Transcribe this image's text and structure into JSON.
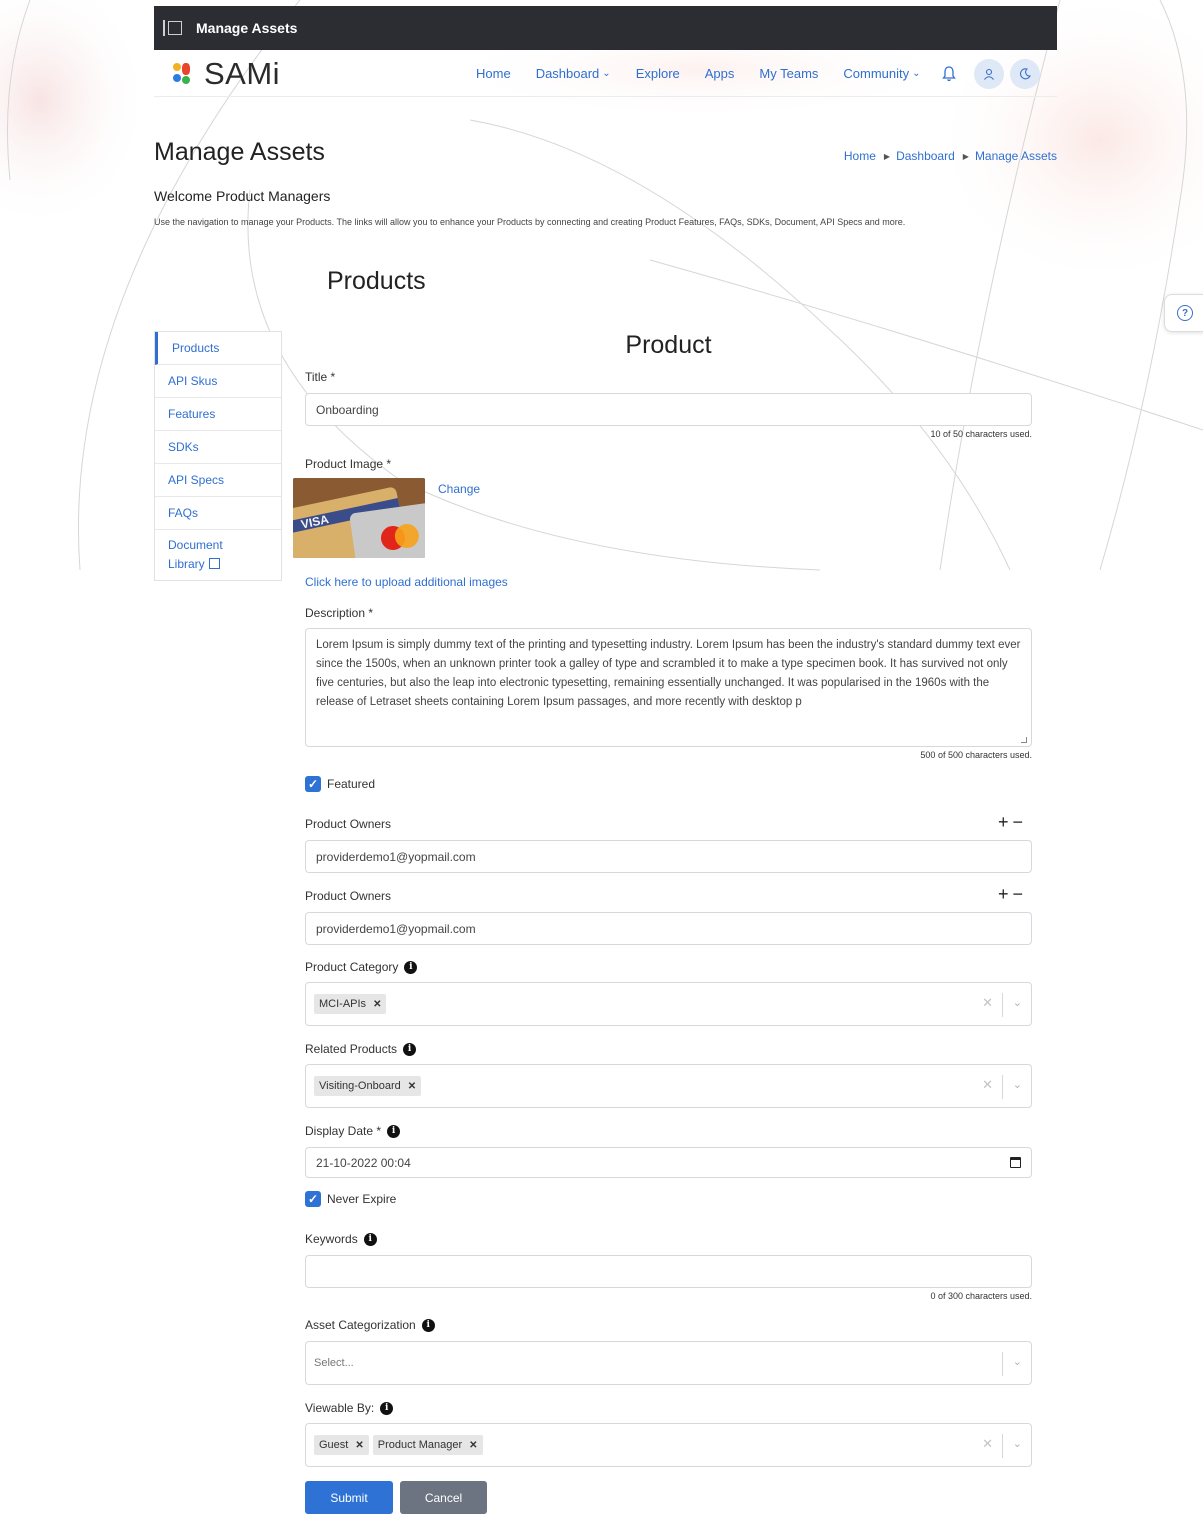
{
  "adminbar": {
    "title": "Manage Assets"
  },
  "nav": {
    "logo_text": "SAMi",
    "menu": [
      {
        "label": "Home",
        "dropdown": false
      },
      {
        "label": "Dashboard",
        "dropdown": true
      },
      {
        "label": "Explore",
        "dropdown": false
      },
      {
        "label": "Apps",
        "dropdown": false
      },
      {
        "label": "My Teams",
        "dropdown": false
      },
      {
        "label": "Community",
        "dropdown": true
      }
    ]
  },
  "page": {
    "title": "Manage Assets",
    "breadcrumb": [
      "Home",
      "Dashboard",
      "Manage Assets"
    ],
    "welcome": "Welcome Product Managers",
    "intro": "Use the navigation to manage your Products. The links will allow you to enhance your Products by connecting and creating Product Features, FAQs, SDKs, Document, API Specs and more.",
    "section_title": "Products"
  },
  "sidemenu": {
    "items": [
      "Products",
      "API Skus",
      "Features",
      "SDKs",
      "API Specs",
      "FAQs"
    ],
    "last_line1": "Document",
    "last_line2": "Library",
    "active": "Products"
  },
  "form": {
    "heading": "Product",
    "title_label": "Title *",
    "title_value": "Onboarding",
    "title_count": "10 of 50 characters used.",
    "image_label": "Product Image *",
    "change_link": "Change",
    "upload_link": "Click here to upload additional images",
    "description_label": "Description *",
    "description_value": "Lorem Ipsum is simply dummy text of the printing and typesetting industry. Lorem Ipsum has been the industry's standard dummy text ever since the 1500s, when an unknown printer took a galley of type and scrambled it to make a type specimen book. It has survived not only five centuries, but also the leap into electronic typesetting, remaining essentially unchanged. It was popularised in the 1960s with the release of Letraset sheets containing Lorem Ipsum passages, and more recently with desktop p",
    "description_count": "500 of 500 characters used.",
    "featured_label": "Featured",
    "featured_checked": true,
    "owners": [
      {
        "label": "Product Owners",
        "value": "providerdemo1@yopmail.com"
      },
      {
        "label": "Product Owners",
        "value": "providerdemo1@yopmail.com"
      }
    ],
    "category_label": "Product Category",
    "category_tags": [
      "MCI-APIs"
    ],
    "related_label": "Related Products",
    "related_tags": [
      "Visiting-Onboard"
    ],
    "display_date_label": "Display Date *",
    "display_date_value": "21-10-2022 00:04",
    "never_expire_label": "Never Expire",
    "never_expire_checked": true,
    "keywords_label": "Keywords",
    "keywords_value": "",
    "keywords_count": "0 of 300 characters used.",
    "asset_cat_label": "Asset Categorization",
    "asset_cat_placeholder": "Select...",
    "viewable_label": "Viewable By:",
    "viewable_tags": [
      "Guest",
      "Product Manager"
    ],
    "submit_label": "Submit",
    "cancel_label": "Cancel"
  },
  "colors": {
    "accent": "#2f72d6",
    "link": "#2f6fd1",
    "cancel": "#6b7480",
    "adminbar": "#2c2d33"
  },
  "icons": [
    "bell-icon",
    "user-icon",
    "moon-icon",
    "help-icon",
    "info-icon",
    "calendar-icon",
    "external-link-icon",
    "checkbox-icon"
  ]
}
